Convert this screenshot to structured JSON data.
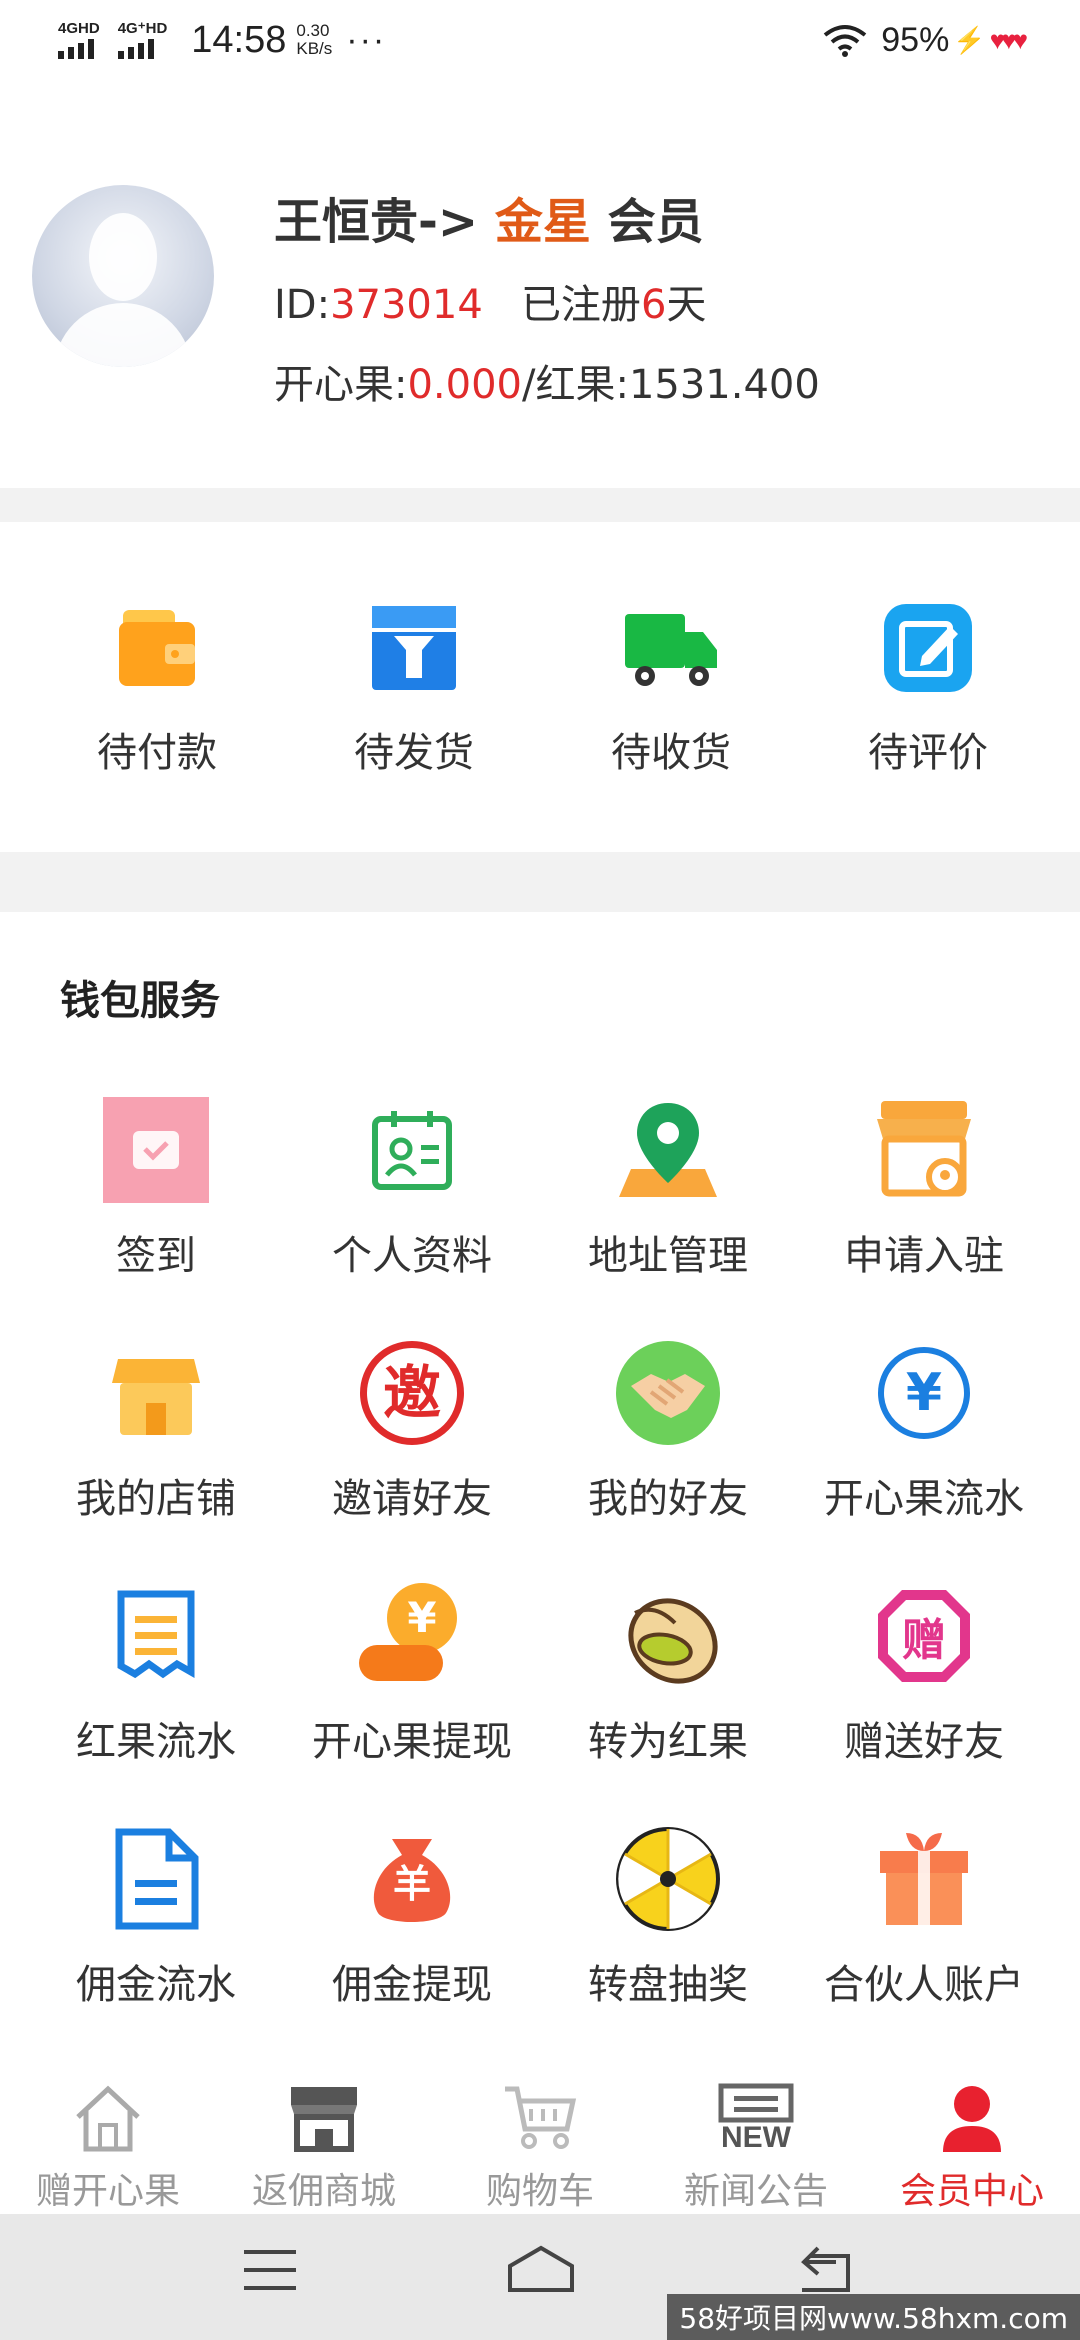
{
  "status_bar": {
    "signal1": "4GHD",
    "signal2": "4G⁺HD",
    "time": "14:58",
    "speed_value": "0.30",
    "speed_unit": "KB/s",
    "more": "···",
    "battery": "95%"
  },
  "profile": {
    "name_prefix": "王恒贵->",
    "level": "金星",
    "member": "会员",
    "id_label": "ID:",
    "id_value": "373014",
    "registered_label": "已注册",
    "registered_days": "6",
    "registered_unit": "天",
    "happy_fruit_label": "开心果:",
    "happy_fruit_value": "0.000",
    "red_fruit_label": "/红果:",
    "red_fruit_value": "1531.400"
  },
  "orders": [
    {
      "label": "待付款",
      "icon": "wallet-icon"
    },
    {
      "label": "待发货",
      "icon": "box-icon"
    },
    {
      "label": "待收货",
      "icon": "truck-icon"
    },
    {
      "label": "待评价",
      "icon": "edit-icon"
    }
  ],
  "wallet": {
    "title": "钱包服务",
    "items": [
      {
        "label": "签到",
        "icon": "checkin-icon"
      },
      {
        "label": "个人资料",
        "icon": "profile-card-icon"
      },
      {
        "label": "地址管理",
        "icon": "location-icon"
      },
      {
        "label": "申请入驻",
        "icon": "store-apply-icon"
      },
      {
        "label": "我的店铺",
        "icon": "shop-icon"
      },
      {
        "label": "邀请好友",
        "icon": "invite-icon"
      },
      {
        "label": "我的好友",
        "icon": "handshake-icon"
      },
      {
        "label": "开心果流水",
        "icon": "yen-circle-icon"
      },
      {
        "label": "红果流水",
        "icon": "list-icon"
      },
      {
        "label": "开心果提现",
        "icon": "coin-hand-icon"
      },
      {
        "label": "转为红果",
        "icon": "pistachio-icon"
      },
      {
        "label": "赠送好友",
        "icon": "gift-badge-icon"
      },
      {
        "label": "佣金流水",
        "icon": "document-icon"
      },
      {
        "label": "佣金提现",
        "icon": "money-bag-icon"
      },
      {
        "label": "转盘抽奖",
        "icon": "wheel-icon"
      },
      {
        "label": "合伙人账户",
        "icon": "gift-box-icon"
      }
    ],
    "invite_char": "邀",
    "gift_char": "赠",
    "yen": "¥",
    "yuan": "羊"
  },
  "bottom_nav": [
    {
      "label": "赠开心果",
      "icon": "home-icon"
    },
    {
      "label": "返佣商城",
      "icon": "mall-icon"
    },
    {
      "label": "购物车",
      "icon": "cart-icon"
    },
    {
      "label": "新闻公告",
      "icon": "news-icon"
    },
    {
      "label": "会员中心",
      "icon": "member-icon"
    }
  ],
  "news_badge": "NEW",
  "watermark": "58好项目网www.58hxm.com",
  "colors": {
    "accent": "#e02b2b",
    "level": "#e05a17",
    "inactive": "#999999"
  }
}
